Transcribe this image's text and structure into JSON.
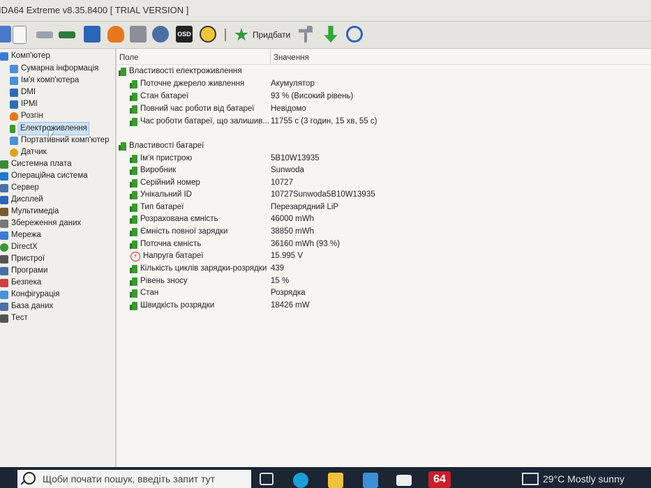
{
  "window": {
    "title": "IDA64 Extreme v8.35.8400  [ TRIAL VERSION ]"
  },
  "toolbar": {
    "add_label": "Придбати"
  },
  "tree": {
    "items": [
      {
        "label": "Комп'ютер",
        "icon": "computer-icon",
        "color": "#3a7bd5"
      },
      {
        "label": "Сумарна інформація",
        "icon": "summary-icon",
        "color": "#4a90d9"
      },
      {
        "label": "Ім'я комп'ютера",
        "icon": "computer-name-icon",
        "color": "#4a90d9"
      },
      {
        "label": "DMI",
        "icon": "dmi-icon",
        "color": "#2d6db5"
      },
      {
        "label": "IPMI",
        "icon": "ipmi-icon",
        "color": "#2d6db5"
      },
      {
        "label": "Розгін",
        "icon": "flame-icon",
        "color": "#e7771d"
      },
      {
        "label": "Електроживлення",
        "icon": "power-icon",
        "color": "#3b9a2f"
      },
      {
        "label": "Портативний комп'ютер",
        "icon": "laptop-icon",
        "color": "#4a90d9"
      },
      {
        "label": "Датчик",
        "icon": "sensor-icon",
        "color": "#e0a020"
      },
      {
        "label": "Системна плата",
        "icon": "motherboard-icon",
        "color": "#3a8a3a"
      },
      {
        "label": "Операційна система",
        "icon": "os-icon",
        "color": "#1f78d1"
      },
      {
        "label": "Сервер",
        "icon": "server-icon",
        "color": "#4a6fa5"
      },
      {
        "label": "Дисплей",
        "icon": "display-icon",
        "color": "#2a65b8"
      },
      {
        "label": "Мультимедіа",
        "icon": "multimedia-icon",
        "color": "#7a5a2a"
      },
      {
        "label": "Збереження даних",
        "icon": "storage-icon",
        "color": "#777777"
      },
      {
        "label": "Мережа",
        "icon": "network-icon",
        "color": "#3a7bd5"
      },
      {
        "label": "DirectX",
        "icon": "directx-icon",
        "color": "#3a9a2f"
      },
      {
        "label": "Пристрої",
        "icon": "devices-icon",
        "color": "#555555"
      },
      {
        "label": "Програми",
        "icon": "programs-icon",
        "color": "#4a6fa5"
      },
      {
        "label": "Безпека",
        "icon": "security-icon",
        "color": "#d04040"
      },
      {
        "label": "Конфігурація",
        "icon": "config-icon",
        "color": "#4a90d9"
      },
      {
        "label": "База даних",
        "icon": "database-icon",
        "color": "#4a6fa5"
      },
      {
        "label": "Тест",
        "icon": "test-icon",
        "color": "#555555"
      }
    ]
  },
  "table": {
    "col_field": "Поле",
    "col_value": "Значення",
    "groups": [
      {
        "title": "Властивості електроживлення",
        "rows": [
          {
            "field": "Поточне джерело живлення",
            "value": "Акумулятор"
          },
          {
            "field": "Стан батареї",
            "value": "93 % (Високий рівень)"
          },
          {
            "field": "Повний час роботи від батареї",
            "value": "Невідомо"
          },
          {
            "field": "Час роботи батареї, що залишив...",
            "value": "11755 с (3 годин, 15 хв, 55 с)"
          }
        ]
      },
      {
        "title": "Властивості батареї",
        "rows": [
          {
            "field": "Ім'я пристрою",
            "value": "5B10W13935"
          },
          {
            "field": "Виробник",
            "value": "Sunwoda"
          },
          {
            "field": "Серійний номер",
            "value": "10727"
          },
          {
            "field": "Унікальний ID",
            "value": "10727Sunwoda5B10W13935"
          },
          {
            "field": "Тип батареї",
            "value": "Перезарядний LiP"
          },
          {
            "field": "Розрахована ємність",
            "value": "46000 mWh"
          },
          {
            "field": "Ємність повної зарядки",
            "value": "38850 mWh"
          },
          {
            "field": "Поточна ємність",
            "value": "36160 mWh  (93 %)"
          },
          {
            "field": "Напруга батареї",
            "value": "15.995 V"
          },
          {
            "field": "Кількість циклів зарядки-розрядки",
            "value": "439"
          },
          {
            "field": "Рівень зносу",
            "value": "15 %"
          },
          {
            "field": "Стан",
            "value": "Розрядка"
          },
          {
            "field": "Швидкість розрядки",
            "value": "18426 mW"
          }
        ]
      }
    ]
  },
  "taskbar": {
    "search_placeholder": "Щоби почати пошук, введіть запит тут",
    "aida_badge": "64",
    "weather": "29°C  Mostly sunny"
  }
}
